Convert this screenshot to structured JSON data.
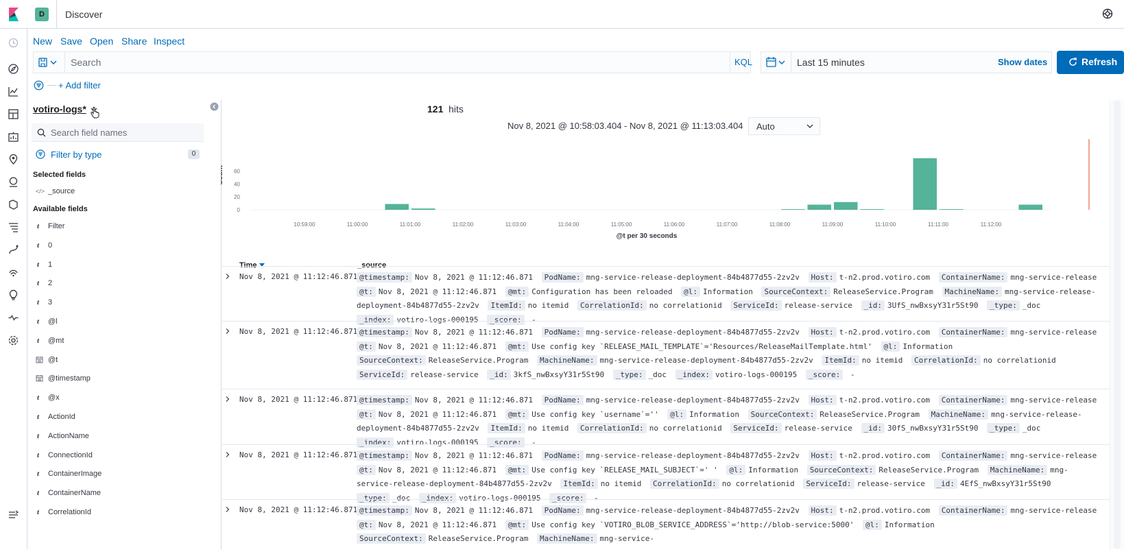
{
  "header": {
    "app_title": "Discover",
    "space_letter": "D"
  },
  "menu": {
    "new": "New",
    "save": "Save",
    "open": "Open",
    "share": "Share",
    "inspect": "Inspect"
  },
  "query": {
    "placeholder": "Search",
    "language": "KQL"
  },
  "time": {
    "range": "Last 15 minutes",
    "show_dates": "Show dates",
    "refresh": "Refresh"
  },
  "filters": {
    "add_label": "+ Add filter"
  },
  "sidebar": {
    "index_pattern": "votiro-logs*",
    "search_placeholder": "Search field names",
    "filter_by_type": "Filter by type",
    "filter_count": "0",
    "selected_heading": "Selected fields",
    "selected_fields": [
      {
        "name": "_source",
        "type": "source"
      }
    ],
    "available_heading": "Available fields",
    "available_fields": [
      {
        "name": "Filter",
        "type": "string"
      },
      {
        "name": "0",
        "type": "string"
      },
      {
        "name": "1",
        "type": "string"
      },
      {
        "name": "2",
        "type": "string"
      },
      {
        "name": "3",
        "type": "string"
      },
      {
        "name": "@l",
        "type": "string"
      },
      {
        "name": "@mt",
        "type": "string"
      },
      {
        "name": "@t",
        "type": "date"
      },
      {
        "name": "@timestamp",
        "type": "date"
      },
      {
        "name": "@x",
        "type": "string"
      },
      {
        "name": "ActionId",
        "type": "string"
      },
      {
        "name": "ActionName",
        "type": "string"
      },
      {
        "name": "ConnectionId",
        "type": "string"
      },
      {
        "name": "ContainerImage",
        "type": "string"
      },
      {
        "name": "ContainerName",
        "type": "string"
      },
      {
        "name": "CorrelationId",
        "type": "string"
      }
    ]
  },
  "results": {
    "hits_count": "121",
    "hits_label": "hits",
    "time_range": "Nov 8, 2021 @ 10:58:03.404 - Nov 8, 2021 @ 11:13:03.404",
    "interval": "Auto"
  },
  "chart_data": {
    "type": "bar",
    "ylabel": "Count",
    "xlabel": "@t per 30 seconds",
    "yticks": [
      "0",
      "20",
      "40",
      "60"
    ],
    "ylim": [
      0,
      84
    ],
    "xticks": [
      "10:59:00",
      "11:00:00",
      "11:01:00",
      "11:02:00",
      "11:03:00",
      "11:04:00",
      "11:05:00",
      "11:06:00",
      "11:07:00",
      "11:08:00",
      "11:09:00",
      "11:10:00",
      "11:11:00",
      "11:12:00"
    ],
    "x_minutes_from_1058": [
      0.5,
      1.5,
      2.0,
      2.5,
      3.0,
      3.5,
      4.0,
      9.5,
      10.0,
      10.5,
      11.0,
      11.5,
      12.5,
      13.0,
      14.5
    ],
    "values": [
      0,
      0,
      0,
      9,
      2,
      0,
      0,
      0,
      1,
      8,
      12,
      1,
      80,
      1,
      8
    ],
    "bar_color": "#54b399",
    "current_time_marker_color": "#e7664c"
  },
  "table": {
    "columns": {
      "time": "Time",
      "source": "_source"
    },
    "rows": [
      {
        "time": "Nov 8, 2021 @ 11:12:46.871",
        "fields": [
          {
            "k": "@timestamp:",
            "v": "Nov 8, 2021 @ 11:12:46.871"
          },
          {
            "k": "PodName:",
            "v": "mng-service-release-deployment-84b4877d55-2zv2v"
          },
          {
            "k": "Host:",
            "v": "t-n2.prod.votiro.com"
          },
          {
            "k": "ContainerName:",
            "v": "mng-service-release"
          },
          {
            "k": "@t:",
            "v": "Nov 8, 2021 @ 11:12:46.871"
          },
          {
            "k": "@mt:",
            "v": "Configuration has been reloaded"
          },
          {
            "k": "@l:",
            "v": "Information"
          },
          {
            "k": "SourceContext:",
            "v": "ReleaseService.Program"
          },
          {
            "k": "MachineName:",
            "v": "mng-service-release-deployment-84b4877d55-2zv2v"
          },
          {
            "k": "ItemId:",
            "v": "no itemid"
          },
          {
            "k": "CorrelationId:",
            "v": "no correlationid"
          },
          {
            "k": "ServiceId:",
            "v": "release-service"
          },
          {
            "k": "_id:",
            "v": "3UfS_nwBxsyY31r5St90"
          },
          {
            "k": "_type:",
            "v": "_doc"
          },
          {
            "k": "_index:",
            "v": "votiro-logs-000195"
          },
          {
            "k": "_score:",
            "v": " -"
          }
        ]
      },
      {
        "time": "Nov 8, 2021 @ 11:12:46.871",
        "fields": [
          {
            "k": "@timestamp:",
            "v": "Nov 8, 2021 @ 11:12:46.871"
          },
          {
            "k": "PodName:",
            "v": "mng-service-release-deployment-84b4877d55-2zv2v"
          },
          {
            "k": "Host:",
            "v": "t-n2.prod.votiro.com"
          },
          {
            "k": "ContainerName:",
            "v": "mng-service-release"
          },
          {
            "k": "@t:",
            "v": "Nov 8, 2021 @ 11:12:46.871"
          },
          {
            "k": "@mt:",
            "v": "Use config key `RELEASE_MAIL_TEMPLATE`='Resources/ReleaseMailTemplate.html'"
          },
          {
            "k": "@l:",
            "v": "Information"
          },
          {
            "k": "SourceContext:",
            "v": "ReleaseService.Program"
          },
          {
            "k": "MachineName:",
            "v": "mng-service-release-deployment-84b4877d55-2zv2v"
          },
          {
            "k": "ItemId:",
            "v": "no itemid"
          },
          {
            "k": "CorrelationId:",
            "v": "no correlationid"
          },
          {
            "k": "ServiceId:",
            "v": "release-service"
          },
          {
            "k": "_id:",
            "v": "3kfS_nwBxsyY31r5St90"
          },
          {
            "k": "_type:",
            "v": "_doc"
          },
          {
            "k": "_index:",
            "v": "votiro-logs-000195"
          },
          {
            "k": "_score:",
            "v": " -"
          }
        ]
      },
      {
        "time": "Nov 8, 2021 @ 11:12:46.871",
        "fields": [
          {
            "k": "@timestamp:",
            "v": "Nov 8, 2021 @ 11:12:46.871"
          },
          {
            "k": "PodName:",
            "v": "mng-service-release-deployment-84b4877d55-2zv2v"
          },
          {
            "k": "Host:",
            "v": "t-n2.prod.votiro.com"
          },
          {
            "k": "ContainerName:",
            "v": "mng-service-release"
          },
          {
            "k": "@t:",
            "v": "Nov 8, 2021 @ 11:12:46.871"
          },
          {
            "k": "@mt:",
            "v": "Use config key `username`=''"
          },
          {
            "k": "@l:",
            "v": "Information"
          },
          {
            "k": "SourceContext:",
            "v": "ReleaseService.Program"
          },
          {
            "k": "MachineName:",
            "v": "mng-service-release-deployment-84b4877d55-2zv2v"
          },
          {
            "k": "ItemId:",
            "v": "no itemid"
          },
          {
            "k": "CorrelationId:",
            "v": "no correlationid"
          },
          {
            "k": "ServiceId:",
            "v": "release-service"
          },
          {
            "k": "_id:",
            "v": "30fS_nwBxsyY31r5St90"
          },
          {
            "k": "_type:",
            "v": "_doc"
          },
          {
            "k": "_index:",
            "v": "votiro-logs-000195"
          },
          {
            "k": "_score:",
            "v": " -"
          }
        ]
      },
      {
        "time": "Nov 8, 2021 @ 11:12:46.871",
        "fields": [
          {
            "k": "@timestamp:",
            "v": "Nov 8, 2021 @ 11:12:46.871"
          },
          {
            "k": "PodName:",
            "v": "mng-service-release-deployment-84b4877d55-2zv2v"
          },
          {
            "k": "Host:",
            "v": "t-n2.prod.votiro.com"
          },
          {
            "k": "ContainerName:",
            "v": "mng-service-release"
          },
          {
            "k": "@t:",
            "v": "Nov 8, 2021 @ 11:12:46.871"
          },
          {
            "k": "@mt:",
            "v": "Use config key `RELEASE_MAIL_SUBJECT`=' '"
          },
          {
            "k": "@l:",
            "v": "Information"
          },
          {
            "k": "SourceContext:",
            "v": "ReleaseService.Program"
          },
          {
            "k": "MachineName:",
            "v": "mng-service-release-deployment-84b4877d55-2zv2v"
          },
          {
            "k": "ItemId:",
            "v": "no itemid"
          },
          {
            "k": "CorrelationId:",
            "v": "no correlationid"
          },
          {
            "k": "ServiceId:",
            "v": "release-service"
          },
          {
            "k": "_id:",
            "v": "4EfS_nwBxsyY31r5St90"
          },
          {
            "k": "_type:",
            "v": "_doc"
          },
          {
            "k": "_index:",
            "v": "votiro-logs-000195"
          },
          {
            "k": "_score:",
            "v": " -"
          }
        ]
      },
      {
        "time": "Nov 8, 2021 @ 11:12:46.871",
        "fields": [
          {
            "k": "@timestamp:",
            "v": "Nov 8, 2021 @ 11:12:46.871"
          },
          {
            "k": "PodName:",
            "v": "mng-service-release-deployment-84b4877d55-2zv2v"
          },
          {
            "k": "Host:",
            "v": "t-n2.prod.votiro.com"
          },
          {
            "k": "ContainerName:",
            "v": "mng-service-release"
          },
          {
            "k": "@t:",
            "v": "Nov 8, 2021 @ 11:12:46.871"
          },
          {
            "k": "@mt:",
            "v": "Use config key `VOTIRO_BLOB_SERVICE_ADDRESS`='http://blob-service:5000'"
          },
          {
            "k": "@l:",
            "v": "Information"
          },
          {
            "k": "SourceContext:",
            "v": "ReleaseService.Program"
          },
          {
            "k": "MachineName:",
            "v": "mng-service-"
          }
        ]
      }
    ]
  }
}
